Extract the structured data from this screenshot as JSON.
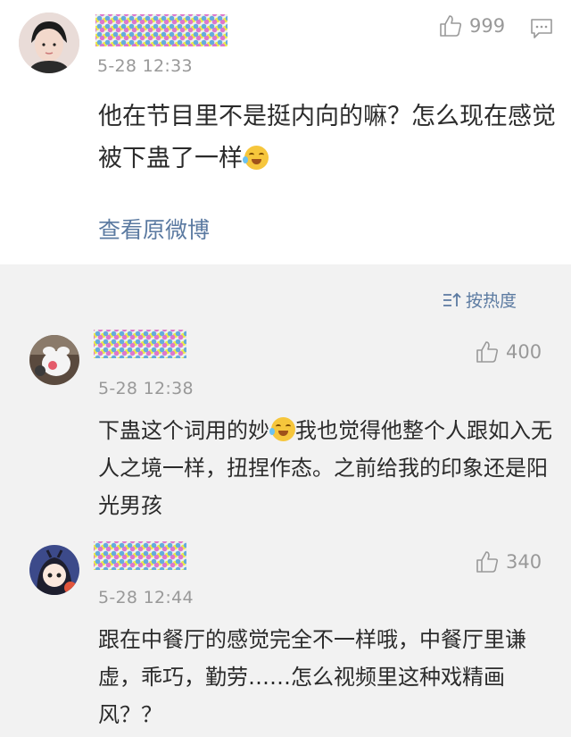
{
  "main_post": {
    "time": "5-28 12:33",
    "likes": "999",
    "text": "他在节目里不是挺内向的嘛？怎么现在感觉被下蛊了一样",
    "view_original": "查看原微博"
  },
  "sort_label": "按热度",
  "comments": [
    {
      "time": "5-28 12:38",
      "likes": "400",
      "text_before": "下蛊这个词用的妙",
      "text_after": "我也觉得他整个人跟如入无人之境一样，扭捏作态。之前给我的印象还是阳光男孩"
    },
    {
      "time": "5-28 12:44",
      "likes": "340",
      "text": "跟在中餐厅的感觉完全不一样哦，中餐厅里谦虚，乖巧，勤劳……怎么视频里这种戏精画风？？"
    }
  ]
}
